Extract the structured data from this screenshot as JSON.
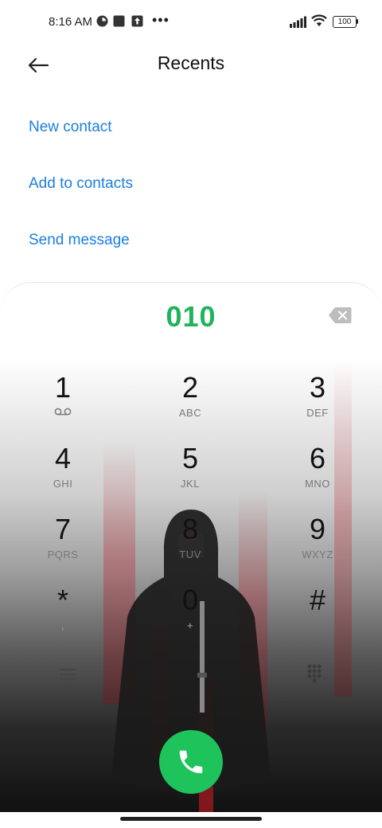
{
  "status_bar": {
    "time": "8:16 AM",
    "battery": "100"
  },
  "header": {
    "title": "Recents"
  },
  "actions": [
    {
      "label": "New contact"
    },
    {
      "label": "Add to contacts"
    },
    {
      "label": "Send message"
    }
  ],
  "dialer": {
    "number": "010",
    "keys": [
      {
        "digit": "1",
        "letters": ""
      },
      {
        "digit": "2",
        "letters": "ABC"
      },
      {
        "digit": "3",
        "letters": "DEF"
      },
      {
        "digit": "4",
        "letters": "GHI"
      },
      {
        "digit": "5",
        "letters": "JKL"
      },
      {
        "digit": "6",
        "letters": "MNO"
      },
      {
        "digit": "7",
        "letters": "PQRS"
      },
      {
        "digit": "8",
        "letters": "TUV"
      },
      {
        "digit": "9",
        "letters": "WXYZ"
      },
      {
        "digit": "*",
        "letters": ","
      },
      {
        "digit": "0",
        "letters": "+"
      },
      {
        "digit": "#",
        "letters": ""
      }
    ]
  },
  "colors": {
    "accent_link": "#1a7fe0",
    "dialed_number": "#1fb45a",
    "call_button": "#1ec35b"
  },
  "icons": [
    "back-arrow-icon",
    "voicemail-icon",
    "backspace-icon",
    "menu-icon",
    "keypad-icon",
    "phone-icon",
    "wifi-icon",
    "signal-icon",
    "battery-icon"
  ]
}
